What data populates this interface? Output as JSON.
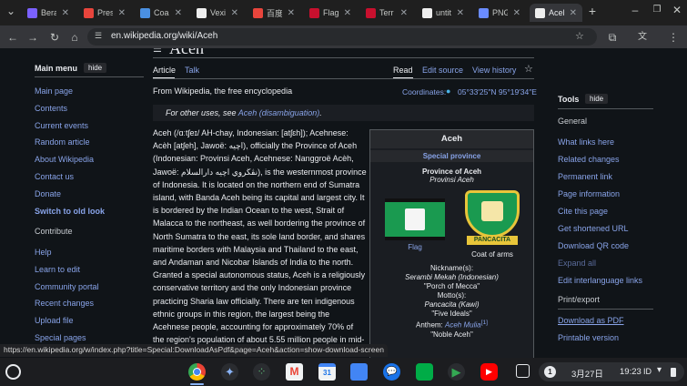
{
  "tabs": [
    {
      "label": "Bera",
      "color": "#7b61ff"
    },
    {
      "label": "Pres",
      "color": "#e8453c"
    },
    {
      "label": "Coal",
      "color": "#4a90e2"
    },
    {
      "label": "Vexi",
      "color": "#eeeeee"
    },
    {
      "label": "百度",
      "color": "#e8453c"
    },
    {
      "label": "Flag",
      "color": "#c8102e"
    },
    {
      "label": "Terr",
      "color": "#c8102e"
    },
    {
      "label": "untit",
      "color": "#eeeeee"
    },
    {
      "label": "PNG",
      "color": "#6a8cff"
    },
    {
      "label": "Acel",
      "color": "#eeeeee",
      "active": true
    }
  ],
  "toolbar": {
    "url": "en.wikipedia.org/wiki/Aceh"
  },
  "article": {
    "title": "Aceh",
    "tab_article": "Article",
    "tab_talk": "Talk",
    "tab_read": "Read",
    "tab_edit": "Edit source",
    "tab_history": "View history",
    "from": "From Wikipedia, the free encyclopedia",
    "coordinates_label": "Coordinates:",
    "coordinates_value": "05°33′25″N 95°19′34″E",
    "hatnote_prefix": "For other uses, see ",
    "hatnote_link": "Aceh (disambiguation)",
    "hatnote_suffix": "."
  },
  "main_menu": {
    "title": "Main menu",
    "hide": "hide",
    "items": [
      "Main page",
      "Contents",
      "Current events",
      "Random article",
      "About Wikipedia",
      "Contact us",
      "Donate",
      "Switch to old look"
    ],
    "contribute_title": "Contribute",
    "contribute_items": [
      "Help",
      "Learn to edit",
      "Community portal",
      "Recent changes",
      "Upload file",
      "Special pages"
    ]
  },
  "tools": {
    "title": "Tools",
    "hide": "hide",
    "general": "General",
    "general_items": [
      "What links here",
      "Related changes",
      "Permanent link",
      "Page information",
      "Cite this page",
      "Get shortened URL",
      "Download QR code",
      "Expand all",
      "Edit interlanguage links"
    ],
    "print_title": "Print/export",
    "print_items": [
      "Download as PDF",
      "Printable version"
    ]
  },
  "body_lines": [
    "Aceh (/ɑːtʃeɪ/ AH-chay, Indonesian: [atʃɛh]); Acehnese:",
    "Acèh [atʃeh], Jawoë: اچيه), officially the Province of Aceh",
    "(Indonesian: Provinsi Aceh, Acehnese: Nanggroë Acèh,",
    "Jawoë: نڤڬروي اچيه دارالسلام), is the westernmost province",
    "of Indonesia. It is located on the northern end of Sumatra",
    "island, with Banda Aceh being its capital and largest city. It",
    "is bordered by the Indian Ocean to the west, Strait of",
    "Malacca to the northeast, as well bordering the province of",
    "North Sumatra to the east, its sole land border, and shares",
    "maritime borders with Malaysia and Thailand to the east,",
    "and Andaman and Nicobar Islands of India to the north.",
    "Granted a special autonomous status, Aceh is a religiously",
    "conservative territory and the only Indonesian province",
    "practicing Sharia law officially. There are ten indigenous",
    "ethnic groups in this region, the largest being the",
    "Acehnese people, accounting for approximately 70% of",
    "the region's population of about 5.55 million people in mid-"
  ],
  "infobox": {
    "title": "Aceh",
    "subtitle": "Special province",
    "name_bold": "Province of Aceh",
    "name_italic": "Provinsi Aceh",
    "flag_caption": "Flag",
    "coat_caption": "Coat of arms",
    "coat_text": "PANCACITA",
    "nickname_label": "Nickname(s):",
    "nickname_value": "Serambi Mekah (Indonesian)",
    "nickname_en": "\"Porch of Mecca\"",
    "motto_label": "Motto(s):",
    "motto_value": "Pancacita (Kawi)",
    "motto_en": "\"Five Ideals\"",
    "anthem_label": "Anthem:",
    "anthem_value": "Aceh Mulia",
    "anthem_ref": "[1]",
    "anthem_en": "\"Noble Aceh\""
  },
  "status_url": "https://en.wikipedia.org/w/index.php?title=Special:DownloadAsPdf&page=Aceh&action=show-download-screen",
  "taskbar": {
    "notification_count": "1",
    "date": "3月27日",
    "time": "19:23",
    "ime": "ID"
  },
  "colors": {
    "link": "#88a3e8",
    "page_bg": "#101418",
    "infobox_header": "#27292d"
  }
}
